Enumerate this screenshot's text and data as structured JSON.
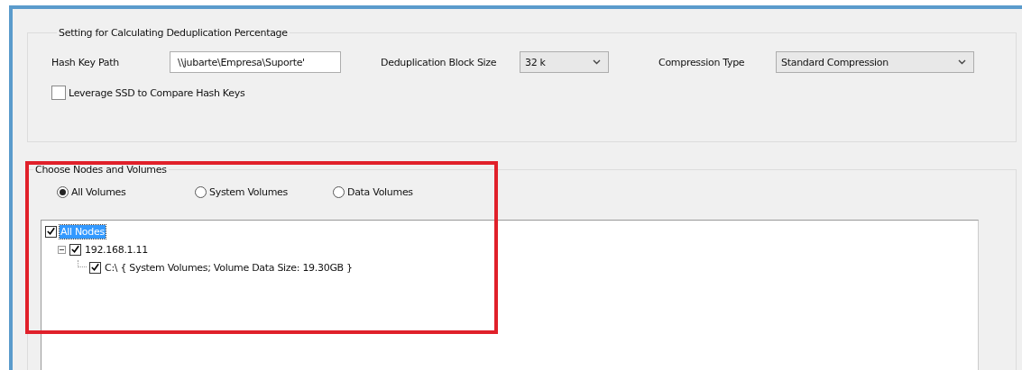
{
  "settings_group": {
    "title": "Setting for Calculating Deduplication Percentage",
    "hash_key_path": {
      "label": "Hash Key Path",
      "value": "\\\\jubarte\\Empresa\\Suporte'"
    },
    "block_size": {
      "label": "Deduplication Block Size",
      "value": "32 k"
    },
    "compression_type": {
      "label": "Compression Type",
      "value": "Standard Compression"
    },
    "leverage_ssd": {
      "label": "Leverage SSD to Compare Hash Keys",
      "checked": false
    }
  },
  "nodes_group": {
    "title": "Choose Nodes and Volumes",
    "volume_options": [
      {
        "label": "All Volumes",
        "selected": true
      },
      {
        "label": "System Volumes",
        "selected": false
      },
      {
        "label": "Data Volumes",
        "selected": false
      }
    ],
    "tree": [
      {
        "label": "All Nodes",
        "checked": true,
        "selected": true,
        "children": [
          {
            "label": "192.168.1.11",
            "checked": true,
            "selected": false,
            "expanded": true,
            "children": [
              {
                "label": "C:\\ { System Volumes; Volume Data Size: 19.30GB }",
                "checked": true,
                "selected": false
              }
            ]
          }
        ]
      }
    ]
  }
}
